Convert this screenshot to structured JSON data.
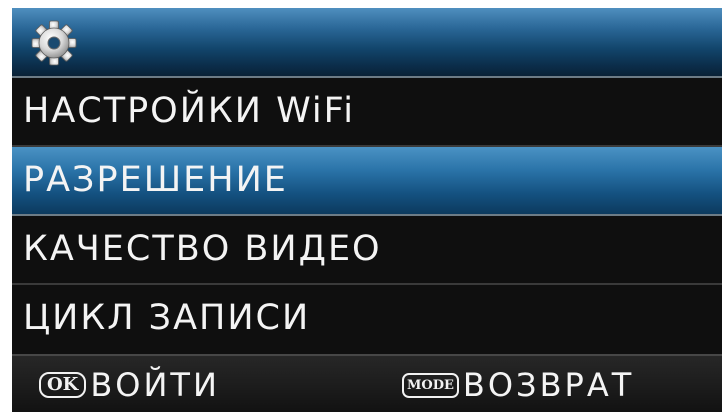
{
  "header": {
    "icon": "gear-icon"
  },
  "menu": {
    "items": [
      {
        "label": "НАСТРОЙКИ WiFi"
      },
      {
        "label": "РАЗРЕШЕНИЕ"
      },
      {
        "label": "КАЧЕСТВО ВИДЕО"
      },
      {
        "label": "ЦИКЛ ЗАПИСИ"
      }
    ],
    "selected_label": "РАЗРЕШЕНИЕ"
  },
  "footer": {
    "ok_key": "OK",
    "ok_label": "ВОЙТИ",
    "mode_key": "MODE",
    "mode_label": "ВОЗВРАТ"
  },
  "colors": {
    "accent": "#2a73a8",
    "background": "#0f0f0f",
    "text": "#f4f4f4"
  }
}
